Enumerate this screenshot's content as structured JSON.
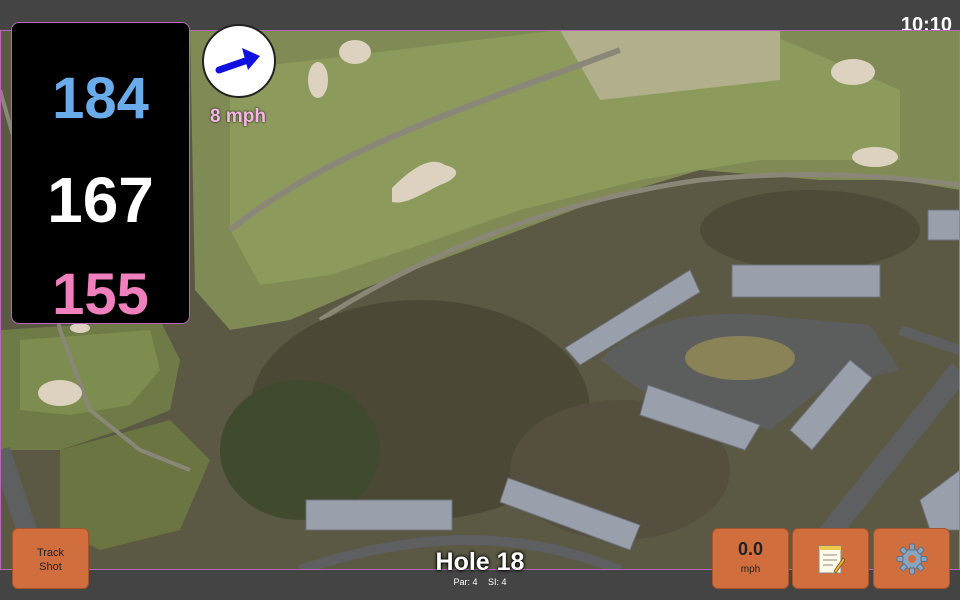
{
  "status": {
    "time": "10:10"
  },
  "distances": {
    "back": "184",
    "middle": "167",
    "front": "155"
  },
  "wind": {
    "speed": "8 mph",
    "icon": "wind-arrow-icon",
    "color": "#1010e0"
  },
  "hole": {
    "title": "Hole 18",
    "par": "Par: 4",
    "si": "SI: 4"
  },
  "buttons": {
    "track_line1": "Track",
    "track_line2": "Shot",
    "speed_value": "0.0",
    "speed_unit": "mph",
    "notes_icon": "notepad-icon",
    "settings_icon": "gear-icon"
  },
  "colors": {
    "back": "#6aabea",
    "middle": "#ffffff",
    "front": "#f07fbe",
    "button": "#d06f3d",
    "accent": "#b46ab4"
  }
}
